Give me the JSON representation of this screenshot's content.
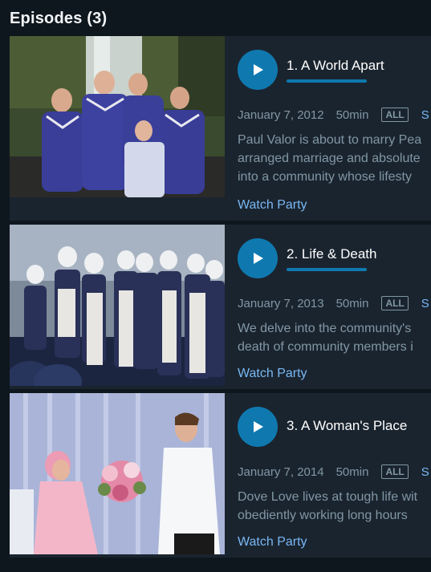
{
  "section": {
    "title": "Episodes (3)"
  },
  "episodes": [
    {
      "title": "1. A World Apart",
      "date": "January 7, 2012",
      "duration": "50min",
      "rating": "ALL",
      "extra": "S",
      "synopsis": [
        "Paul Valor is about to marry Pea",
        "arranged marriage and absolute",
        "into a community whose lifesty"
      ],
      "watch_party": "Watch Party",
      "progress": 1.0
    },
    {
      "title": "2. Life & Death",
      "date": "January 7, 2013",
      "duration": "50min",
      "rating": "ALL",
      "extra": "S",
      "synopsis": [
        "We delve into the community's",
        "death of community members i"
      ],
      "watch_party": "Watch Party",
      "progress": 1.0
    },
    {
      "title": "3. A Woman's Place",
      "date": "January 7, 2014",
      "duration": "50min",
      "rating": "ALL",
      "extra": "S",
      "synopsis": [
        "Dove Love lives at tough life wit",
        "obediently working long hours"
      ],
      "watch_party": "Watch Party",
      "progress": 0
    }
  ],
  "colors": {
    "accent": "#0f79af",
    "link": "#79b8f3",
    "muted": "#8197a4",
    "card": "#1a242f",
    "background": "#0f171e"
  }
}
